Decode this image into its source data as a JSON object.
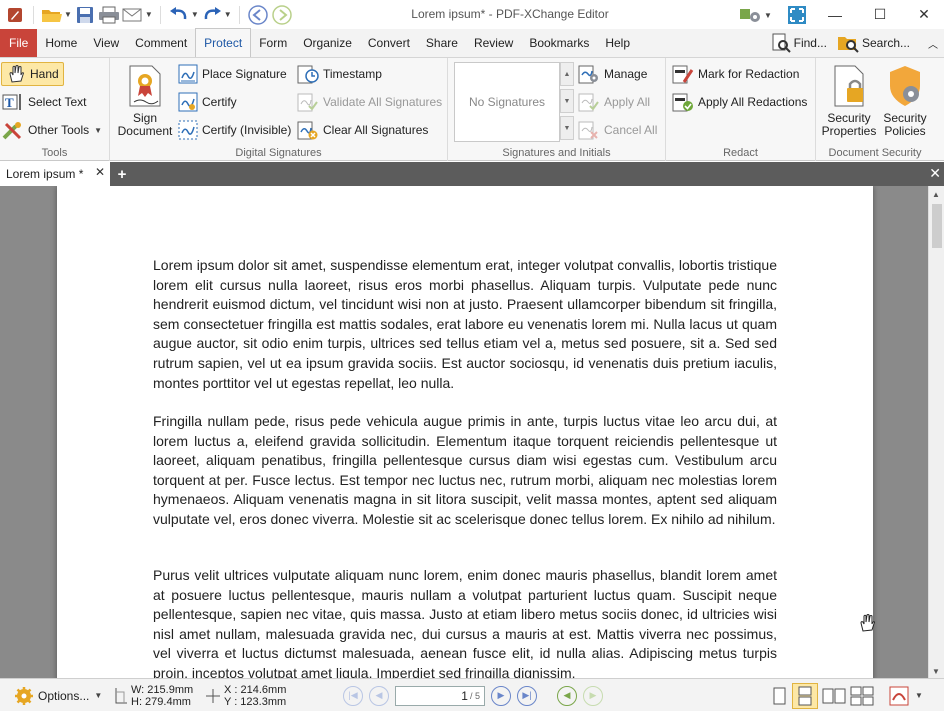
{
  "app": {
    "title": "Lorem ipsum* - PDF-XChange Editor"
  },
  "menu": {
    "tabs": [
      "File",
      "Home",
      "View",
      "Comment",
      "Protect",
      "Form",
      "Organize",
      "Convert",
      "Share",
      "Review",
      "Bookmarks",
      "Help"
    ],
    "active": "Protect",
    "find_label": "Find...",
    "search_label": "Search..."
  },
  "ribbon": {
    "tools": {
      "label": "Tools",
      "hand": "Hand",
      "select_text": "Select Text",
      "other_tools": "Other Tools"
    },
    "digital_signatures": {
      "label": "Digital Signatures",
      "sign_document_line1": "Sign",
      "sign_document_line2": "Document",
      "place_signature": "Place Signature",
      "certify": "Certify",
      "certify_invisible": "Certify (Invisible)",
      "timestamp": "Timestamp",
      "validate_all": "Validate All Signatures",
      "clear_all": "Clear All Signatures"
    },
    "signatures_initials": {
      "label": "Signatures and Initials",
      "empty": "No Signatures",
      "manage": "Manage",
      "apply_all": "Apply All",
      "cancel_all": "Cancel All"
    },
    "redact": {
      "label": "Redact",
      "mark": "Mark for Redaction",
      "apply": "Apply All Redactions"
    },
    "document_security": {
      "label": "Document Security",
      "props_line1": "Security",
      "props_line2": "Properties",
      "policies_line1": "Security",
      "policies_line2": "Policies"
    }
  },
  "doc_tab": {
    "label": "Lorem ipsum *"
  },
  "document": {
    "paragraphs": [
      "Lorem ipsum dolor sit amet, suspendisse elementum erat, integer volutpat convallis, lobortis tristique lorem elit cursus nulla laoreet, risus eros morbi phasellus. Aliquam turpis. Vulputate pede nunc hendrerit euismod dictum, vel tincidunt wisi non at justo. Praesent ullamcorper bibendum sit fringilla, sem consectetuer fringilla est mattis sodales, erat labore eu venenatis lorem mi. Nulla lacus ut quam augue auctor, sit odio enim turpis, ultrices sed tellus etiam vel a, metus sed posuere, sit a. Sed sed rutrum sapien, vel ut ea ipsum gravida sociis. Est auctor sociosqu, id venenatis duis pretium iaculis, montes porttitor vel ut egestas repellat, leo nulla.",
      "Fringilla nullam pede, risus pede vehicula augue primis in ante, turpis luctus vitae leo arcu dui, at lorem luctus a, eleifend gravida sollicitudin. Elementum itaque torquent reiciendis pellentesque ut laoreet, aliquam penatibus, fringilla pellentesque cursus diam wisi egestas cum. Vestibulum arcu torquent at per. Fusce lectus. Est tempor nec luctus nec, rutrum morbi, aliquam nec molestias lorem hymenaeos. Aliquam venenatis magna in sit litora suscipit, velit massa montes, aptent sed aliquam vulputate vel, eros donec viverra. Molestie sit ac scelerisque donec tellus lorem. Ex nihilo ad nihilum.",
      "Purus velit ultrices vulputate aliquam nunc lorem, enim donec mauris phasellus, blandit lorem amet at posuere luctus pellentesque, mauris nullam a volutpat parturient luctus quam. Suscipit neque pellentesque, sapien nec vitae, quis massa. Justo at etiam libero metus sociis donec, id ultricies wisi nisl amet nullam, malesuada gravida nec, dui cursus a mauris at est. Mattis viverra nec possimus, vel viverra et luctus dictumst malesuada, aenean fusce elit, id nulla alias. Adipiscing metus turpis proin, inceptos volutpat amet ligula. Imperdiet sed fringilla dignissim."
    ]
  },
  "status": {
    "options": "Options...",
    "width": "W: 215.9mm",
    "height": "H: 279.4mm",
    "x": "X : 214.6mm",
    "y": "Y : 123.3mm",
    "page_current": "1",
    "page_total": "/ 5"
  },
  "colors": {
    "file_tab": "#c9443a",
    "active_tab_text": "#1e58a6",
    "hand_highlight": "#fde8a6",
    "nav_blue": "#6a86c9"
  }
}
